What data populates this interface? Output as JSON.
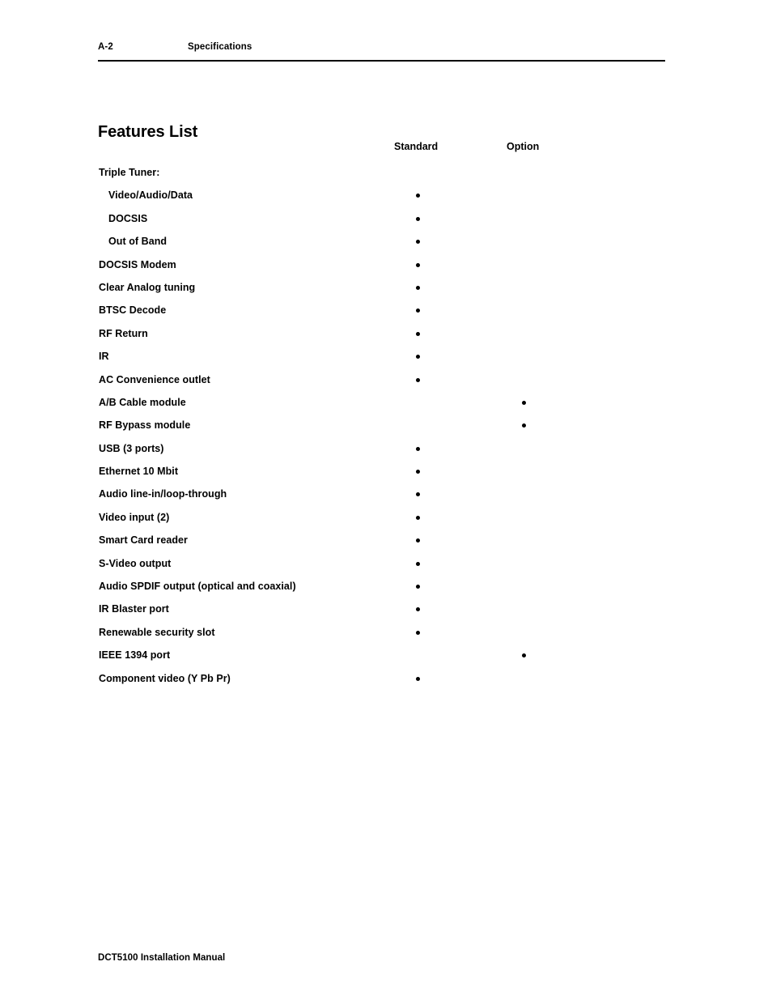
{
  "header": {
    "folio": "A-2",
    "chapter": "Specifications"
  },
  "section": {
    "title": "Features List"
  },
  "columns": {
    "standard": "Standard",
    "option": "Option"
  },
  "features": [
    {
      "label": "Triple Tuner:",
      "indent": false,
      "standard": false,
      "option": false
    },
    {
      "label": "Video/Audio/Data",
      "indent": true,
      "standard": true,
      "option": false
    },
    {
      "label": "DOCSIS",
      "indent": true,
      "standard": true,
      "option": false
    },
    {
      "label": "Out of Band",
      "indent": true,
      "standard": true,
      "option": false
    },
    {
      "label": "DOCSIS Modem",
      "indent": false,
      "standard": true,
      "option": false
    },
    {
      "label": "Clear Analog tuning",
      "indent": false,
      "standard": true,
      "option": false
    },
    {
      "label": "BTSC Decode",
      "indent": false,
      "standard": true,
      "option": false
    },
    {
      "label": "RF Return",
      "indent": false,
      "standard": true,
      "option": false
    },
    {
      "label": "IR",
      "indent": false,
      "standard": true,
      "option": false
    },
    {
      "label": "AC Convenience outlet",
      "indent": false,
      "standard": true,
      "option": false
    },
    {
      "label": "A/B Cable module",
      "indent": false,
      "standard": false,
      "option": true
    },
    {
      "label": "RF Bypass module",
      "indent": false,
      "standard": false,
      "option": true
    },
    {
      "label": "USB (3 ports)",
      "indent": false,
      "standard": true,
      "option": false
    },
    {
      "label": "Ethernet 10 Mbit",
      "indent": false,
      "standard": true,
      "option": false
    },
    {
      "label": "Audio line-in/loop-through",
      "indent": false,
      "standard": true,
      "option": false
    },
    {
      "label": "Video input (2)",
      "indent": false,
      "standard": true,
      "option": false
    },
    {
      "label": "Smart Card reader",
      "indent": false,
      "standard": true,
      "option": false
    },
    {
      "label": "S-Video output",
      "indent": false,
      "standard": true,
      "option": false
    },
    {
      "label": "Audio SPDIF output (optical and coaxial)",
      "indent": false,
      "standard": true,
      "option": false
    },
    {
      "label": "IR Blaster port",
      "indent": false,
      "standard": true,
      "option": false
    },
    {
      "label": "Renewable security slot",
      "indent": false,
      "standard": true,
      "option": false
    },
    {
      "label": "IEEE 1394 port",
      "indent": false,
      "standard": false,
      "option": true
    },
    {
      "label": "Component video (Y Pb Pr)",
      "indent": false,
      "standard": true,
      "option": false
    }
  ],
  "footer": {
    "text": "DCT5100 Installation Manual"
  }
}
